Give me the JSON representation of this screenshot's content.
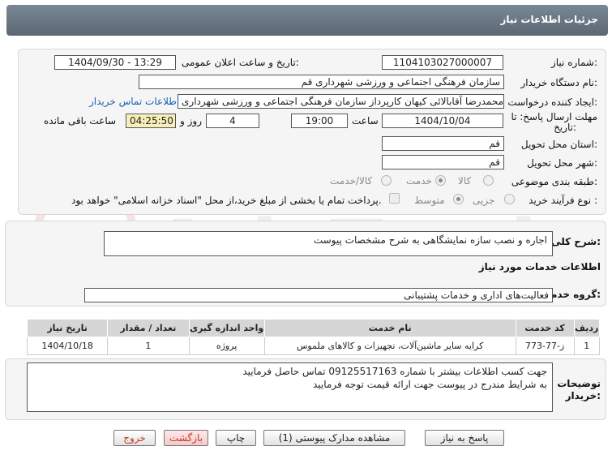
{
  "header": {
    "title": "جزئیات اطلاعات نیاز"
  },
  "form": {
    "need_number_label": "شماره نیاز:",
    "need_number": "1104103027000007",
    "announce_label": "تاریخ و ساعت اعلان عمومی:",
    "announce_value": "1404/09/30 - 13:29",
    "buyer_org_label": "نام دستگاه خریدار:",
    "buyer_org": "سازمان فرهنگی اجتماعی و ورزشی شهرداری قم",
    "creator_label": "ایجاد کننده درخواست:",
    "creator": "محمدرضا آقابالائی کیهان کارپرداز سازمان فرهنگی اجتماعی و ورزشی شهرداری",
    "contact_link": "اطلاعات تماس خریدار",
    "deadline_label_1": "مهلت ارسال پاسخ: تا",
    "deadline_label_2": "تاریخ:",
    "deadline_date": "1404/10/04",
    "time_label": "ساعت",
    "deadline_time": "19:00",
    "days_value": "4",
    "days_label": "روز و",
    "remaining_time": "04:25:50",
    "remaining_label": "ساعت باقی مانده",
    "province_label": "استان محل تحویل:",
    "province": "قم",
    "city_label": "شهر محل تحویل:",
    "city": "قم",
    "category_label": "طبقه بندی موضوعی:",
    "category_options": [
      "کالا",
      "خدمت",
      "کالا/خدمت"
    ],
    "category_selected": "خدمت",
    "process_label": "نوع فرآیند خرید :",
    "process_options": [
      "جزیی",
      "متوسط"
    ],
    "process_selected": "متوسط",
    "payment_note": "پرداخت تمام یا بخشی از مبلغ خرید،از محل \"اسناد خزانه اسلامی\" خواهد بود."
  },
  "description": {
    "label": "شرح کلی نیاز:",
    "value": "اجاره و نصب سازه نمایشگاهی به شرح مشخصات پیوست"
  },
  "services": {
    "section_title": "اطلاعات خدمات مورد نیاز",
    "group_label": "گروه خدمت:",
    "group_value": "فعالیت‌های اداری و خدمات پشتیبانی",
    "columns": [
      "ردیف",
      "کد خدمت",
      "نام خدمت",
      "واحد اندازه گیری",
      "تعداد / مقدار",
      "تاریخ نیاز"
    ],
    "rows": [
      {
        "index": "1",
        "code": "ز-77-773",
        "name": "کرایه سایر ماشین‌آلات، تجهیزات و کالاهای ملموس",
        "unit": "پروژه",
        "qty": "1",
        "date": "1404/10/18"
      }
    ]
  },
  "buyer_notes": {
    "label_1": "توضیحات",
    "label_2": "خریدار:",
    "line_1": "جهت کسب اطلاعات بیشتر با شماره 09125517163 تماس حاصل فرمایید",
    "line_2": "به شرایط مندرج در پیوست جهت ارائه قیمت توجه فرمایید"
  },
  "buttons": {
    "reply": "پاسخ به نیاز",
    "attachments": "مشاهده مدارک پیوستی (1)",
    "print": "چاپ",
    "back": "بازگشت",
    "exit": "خروج"
  },
  "watermark": "AriaTender.neT",
  "colors": {
    "header": "#66727e",
    "link": "#1a5fb4",
    "exit": "#c0392b"
  },
  "icons": {
    "watermark_logo": "aria-tender-logo-icon"
  }
}
